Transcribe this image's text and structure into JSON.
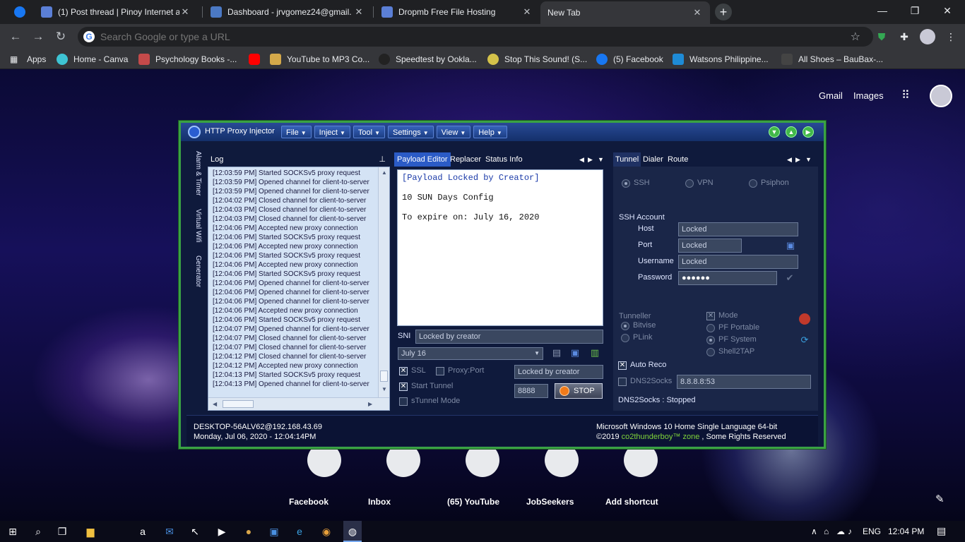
{
  "tabs": [
    {
      "title": "(1) Post thread | Pinoy Internet an",
      "favicon_color": "#5b7fd6"
    },
    {
      "title": "Dashboard - jrvgomez24@gmail.",
      "favicon_color": "#4b79c4"
    },
    {
      "title": "Dropmb Free File Hosting",
      "favicon_color": "#5b7fd6"
    },
    {
      "title": "New Tab",
      "active": true
    }
  ],
  "window_controls": {
    "minimize": "—",
    "restore": "❐",
    "close": "✕"
  },
  "omnibox": {
    "placeholder": "Search Google or type a URL"
  },
  "bookmarks": [
    {
      "label": "Apps",
      "color": "#e8eaed"
    },
    {
      "label": "Home - Canva",
      "color": "#3ec4d4"
    },
    {
      "label": "Psychology Books -...",
      "color": "#c44a4a"
    },
    {
      "label": "YouTube to MP3 Co...",
      "color": "#d4a94a"
    },
    {
      "label": "Speedtest by Ookla...",
      "color": "#222222"
    },
    {
      "label": "Stop This Sound! (S...",
      "color": "#d4c24a"
    },
    {
      "label": "(5) Facebook",
      "color": "#1877f2"
    },
    {
      "label": "Watsons Philippine...",
      "color": "#1e8bd6"
    },
    {
      "label": "All Shoes – BauBax-...",
      "color": "#444444"
    }
  ],
  "ntp": {
    "gmail": "Gmail",
    "images": "Images",
    "shortcuts": [
      "Facebook",
      "Inbox",
      "(65) YouTube",
      "JobSeekers",
      "Add shortcut"
    ]
  },
  "injector": {
    "title": "HTTP Proxy Injector",
    "menus": [
      "File",
      "Inject",
      "Tool",
      "Settings",
      "View",
      "Help"
    ],
    "side_tabs": [
      "Alarm & Timer",
      "Virtual Wifi",
      "Generator"
    ],
    "log": {
      "header": "Log",
      "lines": [
        "[12:03:59 PM] Started SOCKSv5 proxy request",
        "[12:03:59 PM] Opened channel for client-to-server",
        "[12:03:59 PM] Opened channel for client-to-server",
        "[12:04:02 PM] Closed channel for client-to-server",
        "[12:04:03 PM] Closed channel for client-to-server",
        "[12:04:03 PM] Closed channel for client-to-server",
        "[12:04:06 PM] Accepted new proxy connection",
        "[12:04:06 PM] Started SOCKSv5 proxy request",
        "[12:04:06 PM] Accepted new proxy connection",
        "[12:04:06 PM] Started SOCKSv5 proxy request",
        "[12:04:06 PM] Accepted new proxy connection",
        "[12:04:06 PM] Started SOCKSv5 proxy request",
        "[12:04:06 PM] Opened channel for client-to-server",
        "[12:04:06 PM] Opened channel for client-to-server",
        "[12:04:06 PM] Opened channel for client-to-server",
        "[12:04:06 PM] Accepted new proxy connection",
        "[12:04:06 PM] Started SOCKSv5 proxy request",
        "[12:04:07 PM] Opened channel for client-to-server",
        "[12:04:07 PM] Closed channel for client-to-server",
        "[12:04:07 PM] Closed channel for client-to-server",
        "[12:04:12 PM] Closed channel for client-to-server",
        "[12:04:12 PM] Accepted new proxy connection",
        "[12:04:13 PM] Started SOCKSv5 proxy request",
        "[12:04:13 PM] Opened channel for client-to-server"
      ]
    },
    "middle_tabs": [
      "Payload Editor",
      "Replacer",
      "Status Info"
    ],
    "payload_lines": [
      "[Payload Locked by Creator]",
      "",
      "10 SUN Days Config",
      "",
      "To expire on: July 16, 2020"
    ],
    "sni_label": "SNI",
    "sni_value": "Locked by creator",
    "profile_value": "July 16",
    "ssl_label": "SSL",
    "proxy_port_label": "Proxy:Port",
    "proxy_value": "Locked by creator",
    "start_tunnel_label": "Start Tunnel",
    "port_value": "8888",
    "stop_label": "STOP",
    "stunnel_label": "sTunnel Mode",
    "right_tabs": [
      "Tunnel",
      "Dialer",
      "Route"
    ],
    "modes": [
      "SSH",
      "VPN",
      "Psiphon"
    ],
    "ssh_account_label": "SSH Account",
    "host_label": "Host",
    "host_value": "Locked",
    "port_label": "Port",
    "port_field_value": "Locked",
    "username_label": "Username",
    "username_value": "Locked",
    "password_label": "Password",
    "password_value": "●●●●●●",
    "tunneller_label": "Tunneller",
    "bitvise_label": "Bitvise",
    "plink_label": "PLink",
    "mode_label": "Mode",
    "pf_portable_label": "PF Portable",
    "pf_system_label": "PF System",
    "shell2tap_label": "Shell2TAP",
    "auto_reco_label": "Auto Reco",
    "dns2socks_label": "DNS2Socks",
    "dns_value": "8.8.8.8:53",
    "dns_status": "DNS2Socks : Stopped",
    "status_host": "DESKTOP-56ALV62@192.168.43.69",
    "status_time": "Monday, Jul 06, 2020 - 12:04:14PM",
    "status_os": "Microsoft Windows 10 Home Single Language 64-bit",
    "status_copy_prefix": "©2019 ",
    "status_copy_brand": "co2thunderboy™ zone",
    "status_copy_suffix": " , Some Rights Reserved",
    "brand_color": "#7fd43a"
  },
  "taskbar": {
    "language": "ENG",
    "clock": "12:04 PM"
  }
}
